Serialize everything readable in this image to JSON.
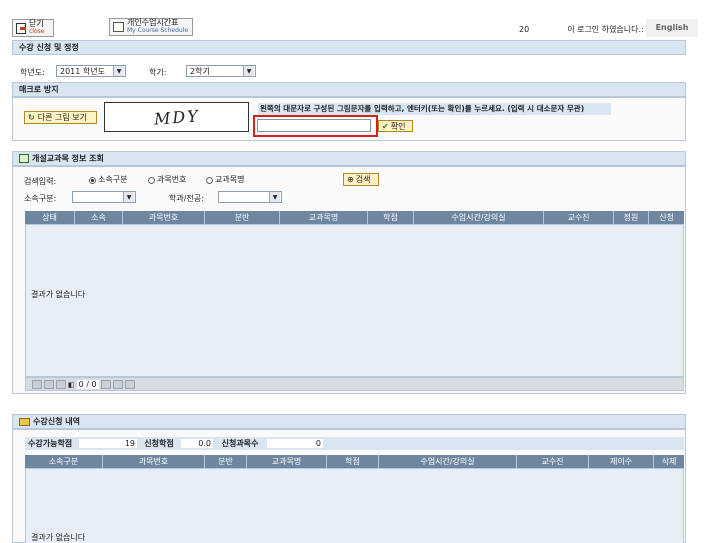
{
  "topbar": {
    "close_label": "닫기",
    "close_sub": "close",
    "schedule_label": "개인수업시간표",
    "schedule_sub": "My Course Schedule",
    "login_prefix": "20",
    "login_suffix": "이 로그인 하였습니다.:",
    "english_label": "English"
  },
  "page_title": "수강 신청 및 정정",
  "term": {
    "year_label": "학년도:",
    "year_value": "2011 학년도",
    "semester_label": "학기:",
    "semester_value": "2학기"
  },
  "macro": {
    "title": "매크로 방지",
    "other_image_button": "다른 그림 보기",
    "captcha_text": "MDY",
    "instruction": "왼쪽의 대문자로 구성된 그림문자를 입력하고, 엔터키(또는 확인)를 누르세요. (입력 시 대소문자 무관)",
    "input_value": "",
    "confirm_button": "확인"
  },
  "course_search": {
    "title": "개설교과목 정보 조회",
    "search_input_label": "검색입력:",
    "radio_options": [
      "소속구분",
      "과목번호",
      "교과목명"
    ],
    "selected_radio": 0,
    "search_button": "검색",
    "dept_label": "소속구분:",
    "dept_value": "",
    "major_label": "학과/전공:",
    "major_value": "",
    "columns": [
      "상태",
      "소속",
      "과목번호",
      "분반",
      "교과목명",
      "학점",
      "수업시간/강의실",
      "교수진",
      "정원",
      "신청"
    ],
    "empty_message": "결과가 없습니다",
    "pager_text": "0 / 0"
  },
  "registration": {
    "title": "수강신청 내역",
    "credits_available_label": "수강가능학점",
    "credits_available_value": "19",
    "credits_applied_label": "신청학점",
    "credits_applied_value": "0.0",
    "courses_applied_label": "신청과목수",
    "courses_applied_value": "0",
    "columns": [
      "소속구분",
      "과목번호",
      "분반",
      "교과목명",
      "학점",
      "수업시간/강의실",
      "교수진",
      "재이수",
      "삭제"
    ],
    "empty_message": "결과가 없습니다"
  }
}
